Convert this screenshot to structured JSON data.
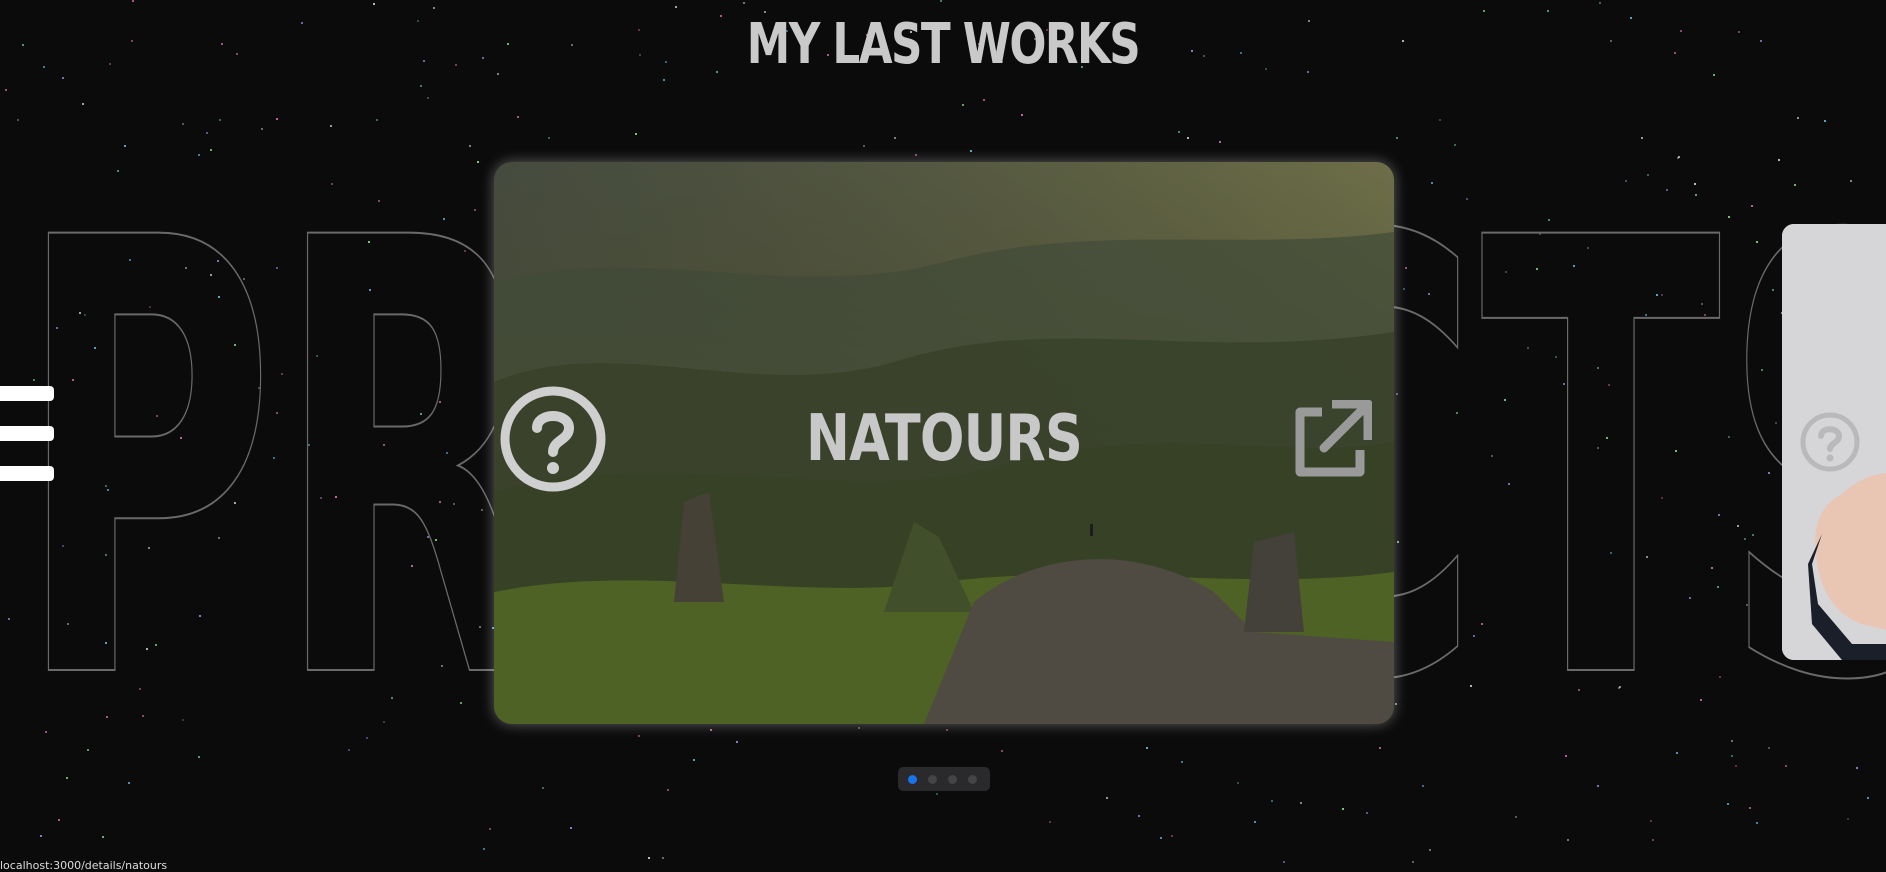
{
  "section": {
    "title": "MY LAST WORKS",
    "background_word": "PROJECTS"
  },
  "menu": {
    "icon": "hamburger-menu-icon"
  },
  "slider": {
    "active_slide": 1,
    "slide_count": 4,
    "current": {
      "title": "NATOURS",
      "info_icon": "question-circle-icon",
      "open_icon": "external-link-icon"
    },
    "next": {
      "info_icon": "question-circle-icon"
    }
  },
  "status_bar": {
    "url": "localhost:3000/details/natours"
  },
  "colors": {
    "background": "#0b0b0c",
    "accent": "#1a73e8",
    "text": "#c9c9c9"
  }
}
